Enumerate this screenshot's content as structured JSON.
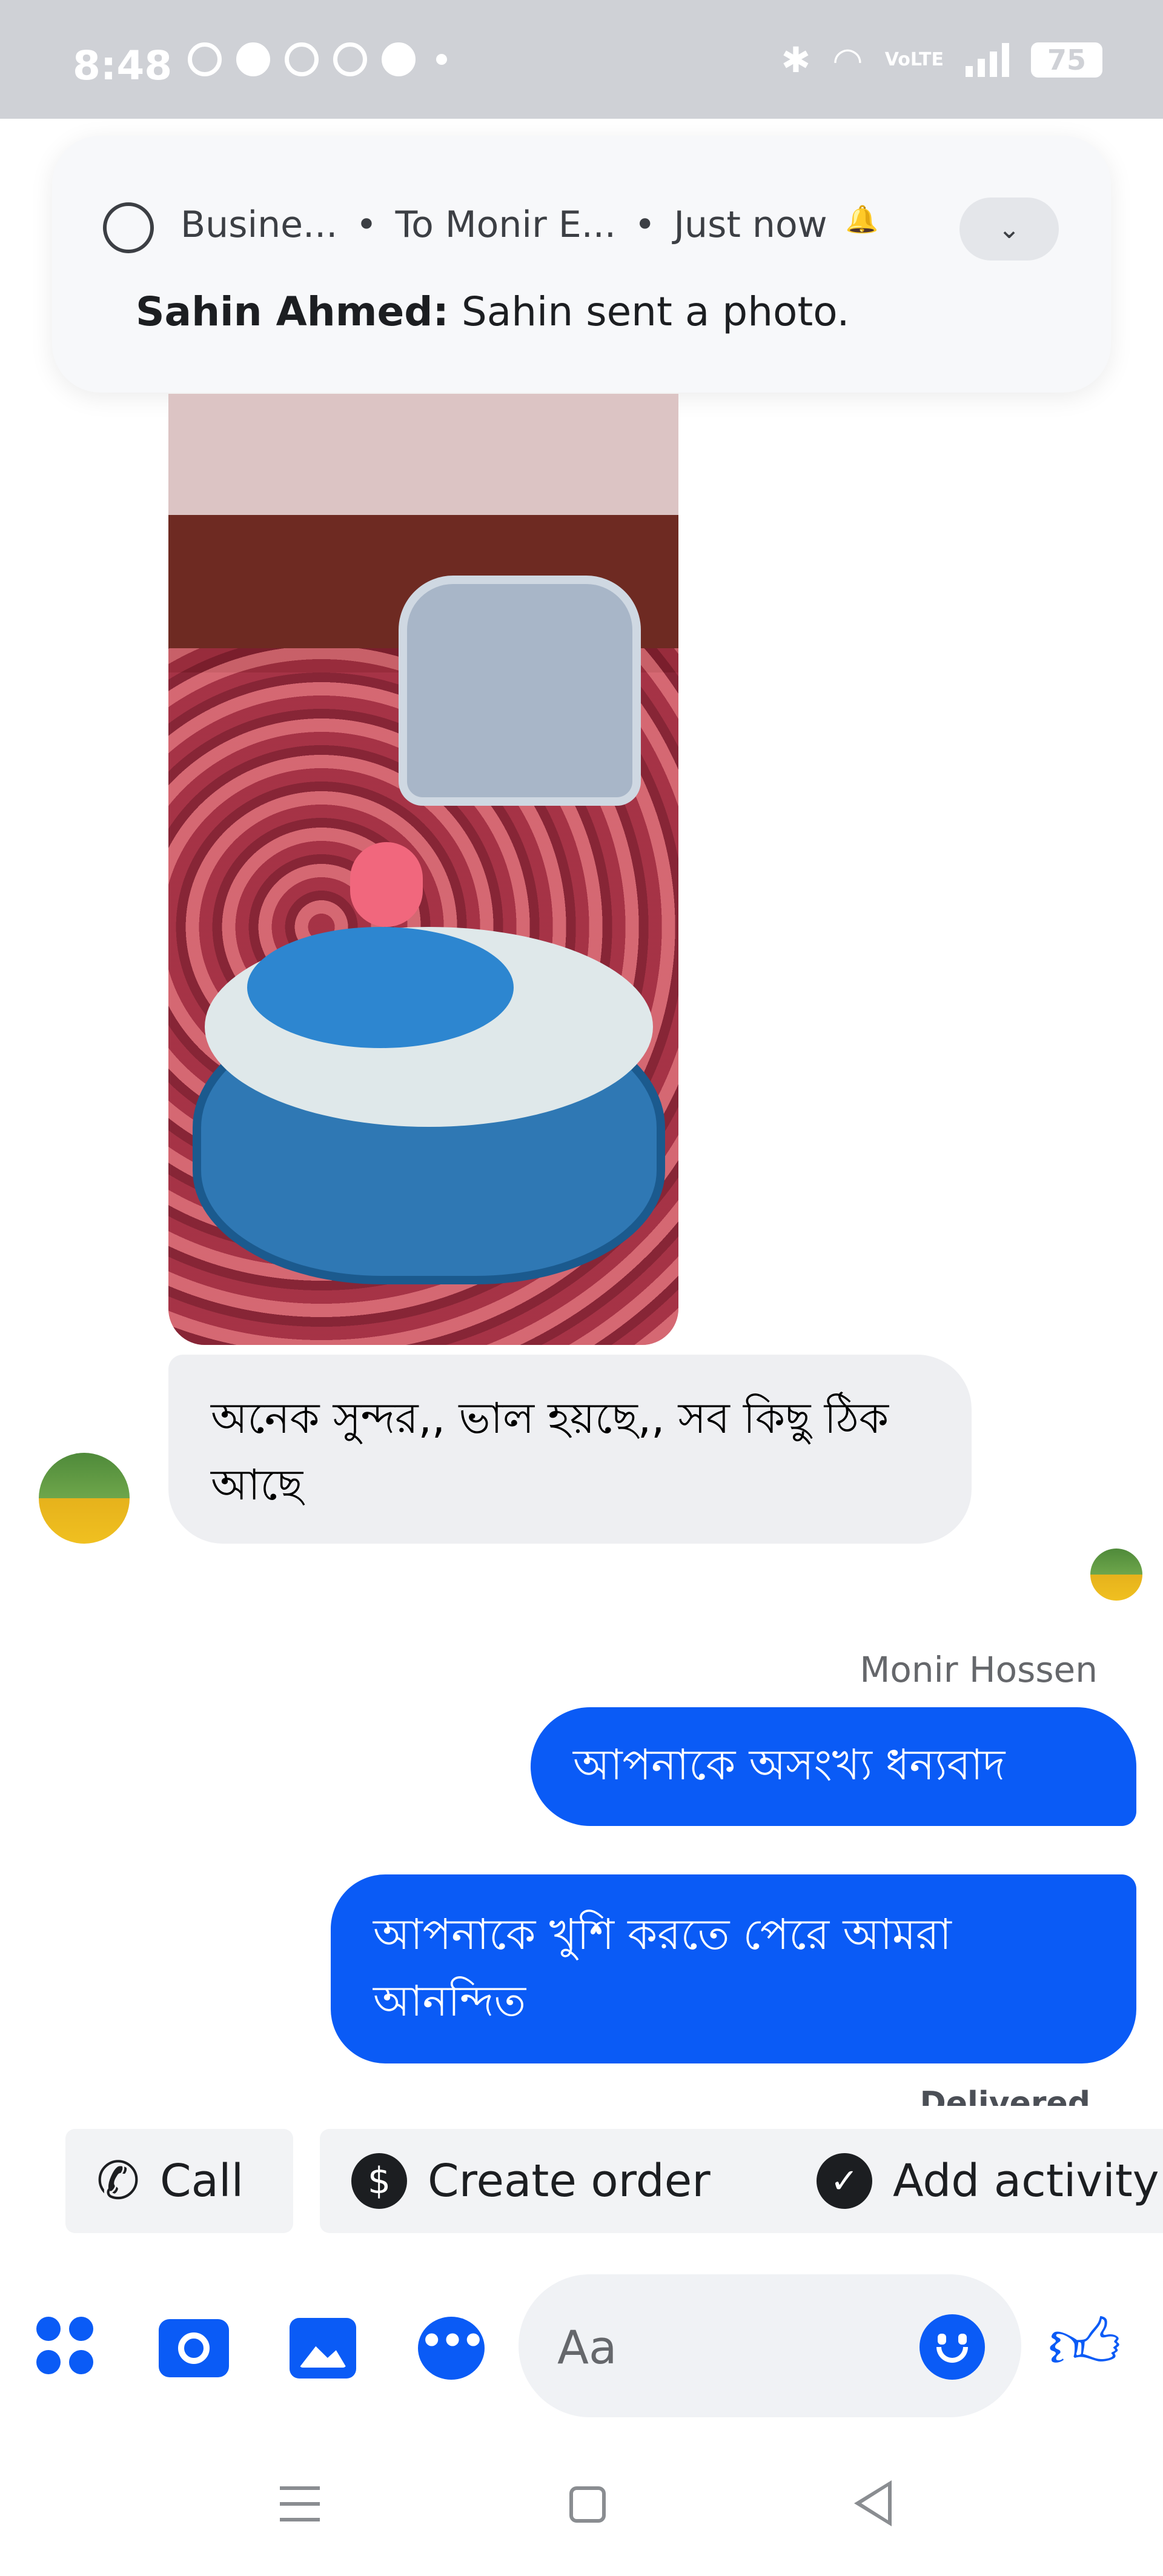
{
  "status_bar": {
    "time": "8:48",
    "battery": "75",
    "network": "VoLTE"
  },
  "notification": {
    "app": "Busine...",
    "separator1": "•",
    "to": "To Monir E...",
    "separator2": "•",
    "when": "Just now",
    "sender": "Sahin Ahmed:",
    "message": "Sahin sent a photo."
  },
  "conversation": {
    "received_text": "অনেক সুন্দর,, ভাল হয়ছে,, সব কিছু ঠিক আছে",
    "sender_name": "Monir Hossen",
    "sent": [
      {
        "text": "আপনাকে অসংখ্য ধন্যবাদ"
      },
      {
        "text": "আপনাকে খুশি করতে পেরে আমরা আনন্দিত"
      }
    ],
    "status": "Delivered"
  },
  "quick_actions": {
    "call": "Call",
    "create_order": "Create order",
    "add_activity": "Add activity"
  },
  "composer": {
    "placeholder": "Aa"
  },
  "colors": {
    "accent": "#0a5bf6",
    "received_bubble": "#eeeff2",
    "status_bar": "#cfd1d6"
  }
}
